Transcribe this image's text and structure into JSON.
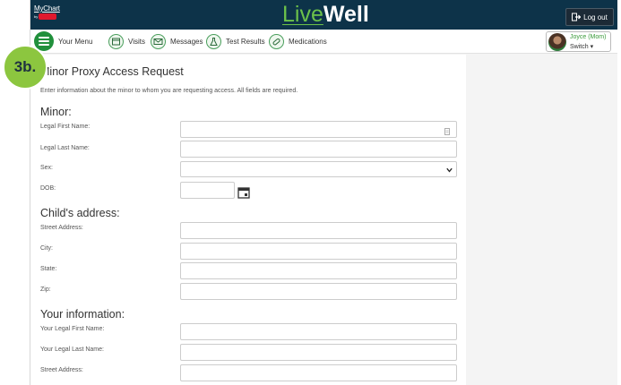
{
  "header": {
    "mychart_logo_text": "MyChart",
    "mychart_logo_sub": "by",
    "brand_part1": "Live",
    "brand_part2": "Well",
    "logout_label": "Log out"
  },
  "nav": {
    "menu_label": "Your Menu",
    "items": [
      {
        "label": "Visits",
        "icon": "calendar-icon"
      },
      {
        "label": "Messages",
        "icon": "envelope-icon"
      },
      {
        "label": "Test Results",
        "icon": "flask-icon"
      },
      {
        "label": "Medications",
        "icon": "pill-icon"
      }
    ],
    "user_name": "Joyce (Mom)",
    "switch_label": "Switch"
  },
  "step_badge": "3b.",
  "form": {
    "title": "Minor Proxy Access Request",
    "intro": "Enter information about the minor to whom you are requesting access. All fields are required.",
    "sections": {
      "minor": "Minor:",
      "address": "Child's address:",
      "your_info": "Your information:"
    },
    "labels": {
      "first_name": "Legal First Name:",
      "last_name": "Legal Last Name:",
      "sex": "Sex:",
      "dob": "DOB:",
      "street": "Street Address:",
      "city": "City:",
      "state": "State:",
      "zip": "Zip:",
      "your_first": "Your Legal First Name:",
      "your_last": "Your Legal Last Name:",
      "your_street": "Street Address:"
    },
    "values": {
      "first_name": "",
      "last_name": "",
      "sex": "",
      "dob": "",
      "street": "",
      "city": "",
      "state": "",
      "zip": "",
      "your_first": "",
      "your_last": "",
      "your_street": ""
    }
  },
  "colors": {
    "header_bg": "#0d3349",
    "brand_green": "#6cc24a",
    "nav_green": "#21903c",
    "badge_green": "#8cc63f"
  }
}
